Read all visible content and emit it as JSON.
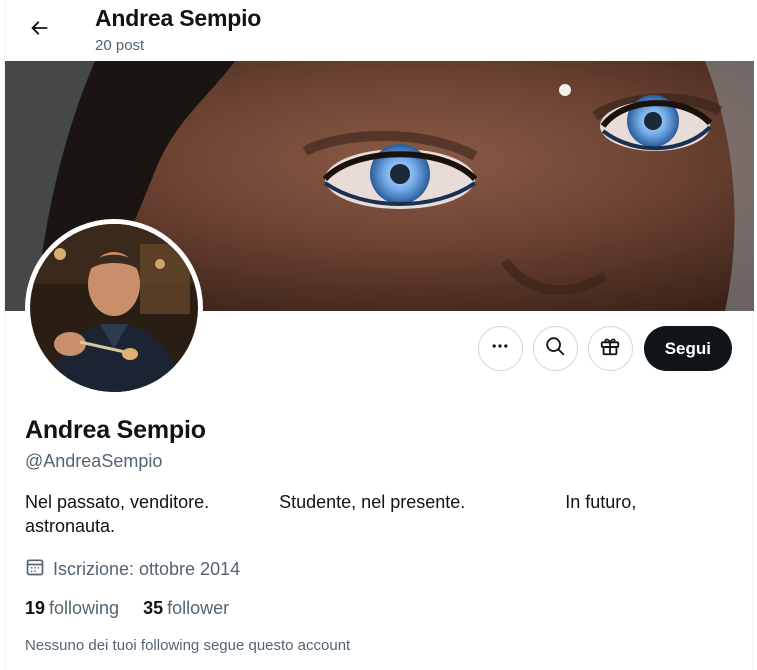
{
  "header": {
    "name": "Andrea Sempio",
    "post_count": "20 post"
  },
  "profile": {
    "name": "Andrea Sempio",
    "handle": "@AndreaSempio",
    "bio": "Nel passato, venditore.              Studente, nel presente.                    In futuro, astronauta.",
    "joined": "Iscrizione: ottobre 2014",
    "following_count": "19",
    "following_label": "following",
    "followers_count": "35",
    "followers_label": "follower",
    "mutuals_notice": "Nessuno dei tuoi following segue questo account"
  },
  "actions": {
    "follow_label": "Segui"
  },
  "icons": {
    "back": "back-arrow-icon",
    "more": "more-icon",
    "search": "search-icon",
    "gift": "gift-icon",
    "calendar": "calendar-icon"
  },
  "colors": {
    "text_primary": "#0f1419",
    "text_secondary": "#536471",
    "follow_button": "#0f1419",
    "border": "#cfd9de"
  }
}
